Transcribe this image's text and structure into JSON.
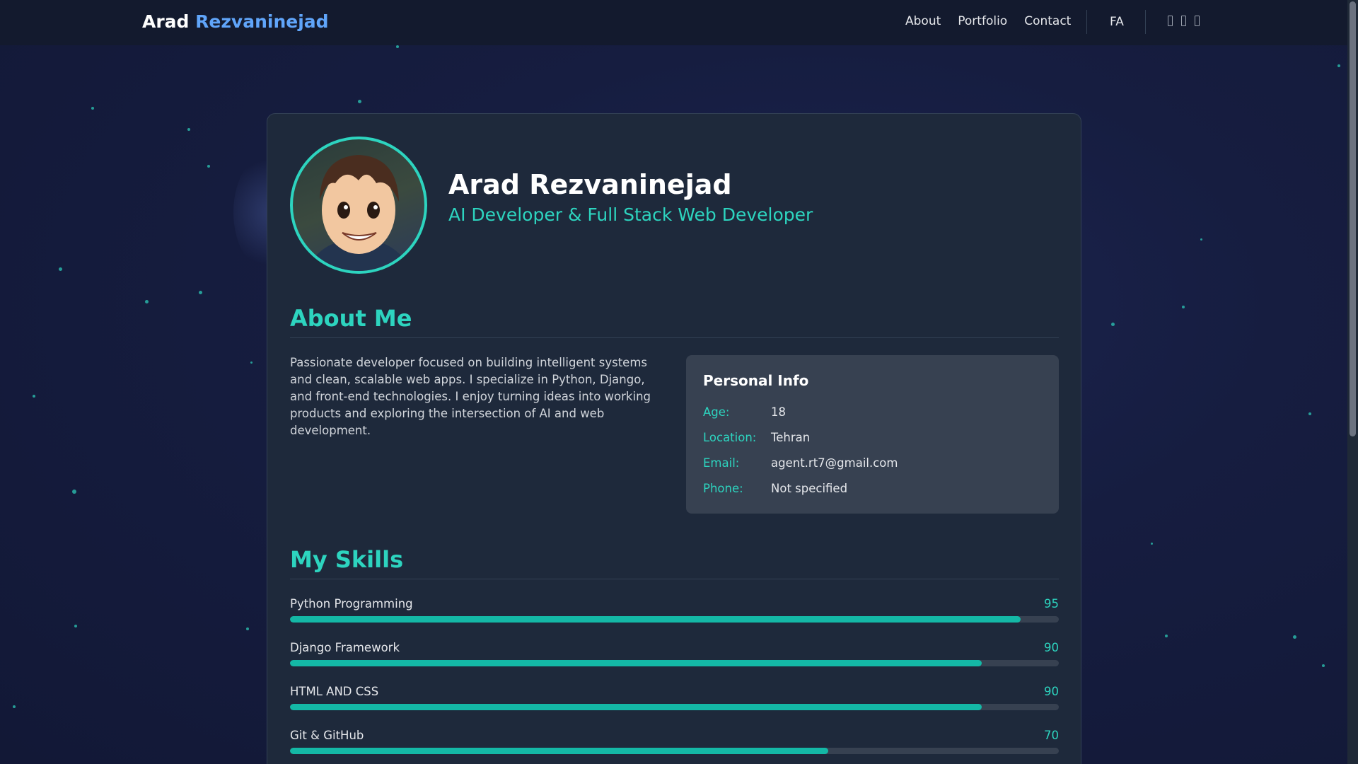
{
  "nav": {
    "brand_first": "Arad",
    "brand_last": "Rezvaninejad",
    "links": [
      "About",
      "Portfolio",
      "Contact"
    ],
    "lang": "FA"
  },
  "profile": {
    "name": "Arad Rezvaninejad",
    "role": "AI Developer & Full Stack Web Developer"
  },
  "about": {
    "title": "About Me",
    "text": "Passionate developer focused on building intelligent systems and clean, scalable web apps. I specialize in Python, Django, and front-end technologies. I enjoy turning ideas into working products and exploring the intersection of AI and web development."
  },
  "personal_info": {
    "title": "Personal Info",
    "rows": [
      {
        "key": "Age:",
        "value": "18"
      },
      {
        "key": "Location:",
        "value": "Tehran"
      },
      {
        "key": "Email:",
        "value": "agent.rt7@gmail.com"
      },
      {
        "key": "Phone:",
        "value": "Not specified"
      }
    ]
  },
  "skills": {
    "title": "My Skills",
    "items": [
      {
        "name": "Python Programming",
        "value": 95
      },
      {
        "name": "Django Framework",
        "value": 90
      },
      {
        "name": "HTML AND CSS",
        "value": 90
      },
      {
        "name": "Git & GitHub",
        "value": 70
      }
    ]
  },
  "colors": {
    "accent": "#2dd4bf",
    "brand_accent": "#60a5fa",
    "bar_fill": "#14b8a6"
  }
}
